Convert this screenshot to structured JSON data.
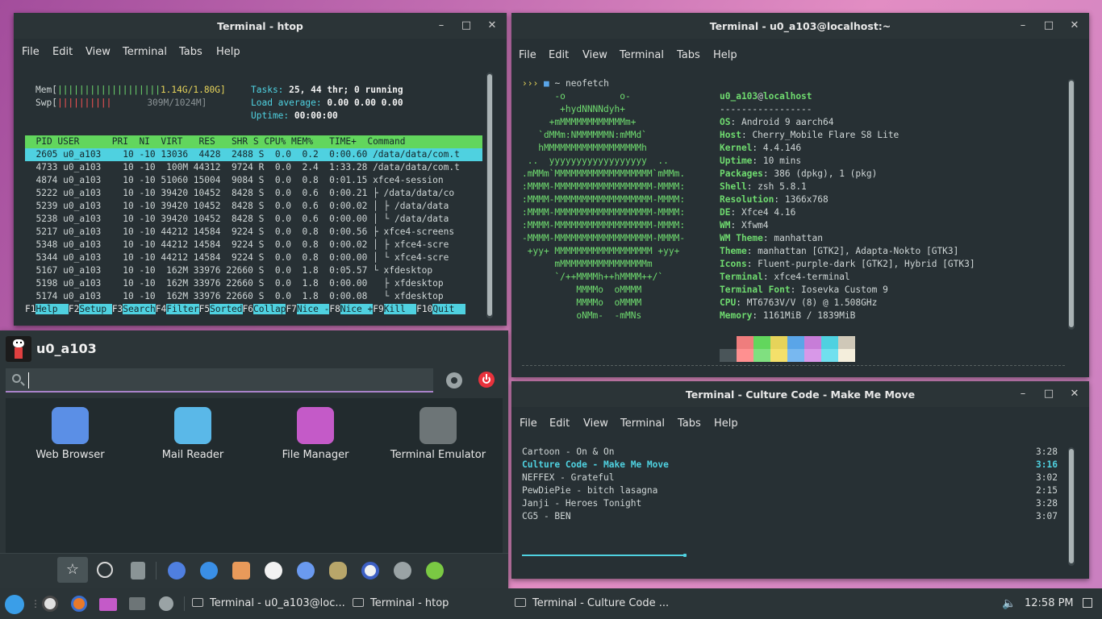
{
  "htop": {
    "title": "Terminal - htop",
    "menu": [
      "File",
      "Edit",
      "View",
      "Terminal",
      "Tabs",
      "Help"
    ],
    "mem_label": "Mem[",
    "mem_bar": "|||||||||||||||||||",
    "mem_val": "1.14G/1.80G]",
    "swp_label": "Swp[",
    "swp_bar": "||||||||||",
    "swp_val": "309M/1024M]",
    "tasks_label": "Tasks:",
    "tasks_val": "25, 44 thr; 0 running",
    "load_label": "Load average:",
    "load_val": "0.00 0.00 0.00",
    "uptime_label": "Uptime:",
    "uptime_val": "00:00:00",
    "header": "  PID USER      PRI  NI  VIRT   RES   SHR S CPU% MEM%   TIME+  Command",
    "rows": [
      "  2605 u0_a103    10 -10 13036  4428  2488 S  0.0  0.2  0:00.60 /data/data/com.t",
      "  4733 u0_a103    10 -10  100M 44312  9724 R  0.0  2.4  1:33.28 /data/data/com.t",
      "  4874 u0_a103    10 -10 51060 15004  9084 S  0.0  0.8  0:01.15 xfce4-session",
      "  5222 u0_a103    10 -10 39420 10452  8428 S  0.0  0.6  0:00.21 ├ /data/data/co",
      "  5239 u0_a103    10 -10 39420 10452  8428 S  0.0  0.6  0:00.02 │ ├ /data/data",
      "  5238 u0_a103    10 -10 39420 10452  8428 S  0.0  0.6  0:00.00 │ └ /data/data",
      "  5217 u0_a103    10 -10 44212 14584  9224 S  0.0  0.8  0:00.56 ├ xfce4-screens",
      "  5348 u0_a103    10 -10 44212 14584  9224 S  0.0  0.8  0:00.02 │ ├ xfce4-scre",
      "  5344 u0_a103    10 -10 44212 14584  9224 S  0.0  0.8  0:00.00 │ └ xfce4-scre",
      "  5167 u0_a103    10 -10  162M 33976 22660 S  0.0  1.8  0:05.57 └ xfdesktop",
      "  5198 u0_a103    10 -10  162M 33976 22660 S  0.0  1.8  0:00.00   ├ xfdesktop",
      "  5174 u0_a103    10 -10  162M 33976 22660 S  0.0  1.8  0:00.08   └ xfdesktop"
    ],
    "fkeys": [
      {
        "k": "F1",
        "l": "Help  "
      },
      {
        "k": "F2",
        "l": "Setup "
      },
      {
        "k": "F3",
        "l": "Search"
      },
      {
        "k": "F4",
        "l": "Filter"
      },
      {
        "k": "F5",
        "l": "Sorted"
      },
      {
        "k": "F6",
        "l": "Collap"
      },
      {
        "k": "F7",
        "l": "Nice -"
      },
      {
        "k": "F8",
        "l": "Nice +"
      },
      {
        "k": "F9",
        "l": "Kill  "
      },
      {
        "k": "F10",
        "l": "Quit  "
      }
    ]
  },
  "neofetch": {
    "title": "Terminal - u0_a103@localhost:~",
    "menu": [
      "File",
      "Edit",
      "View",
      "Terminal",
      "Tabs",
      "Help"
    ],
    "prompt": "›››",
    "prompt_dir": "~",
    "command": "neofetch",
    "art": [
      "      -o          o-",
      "       +hydNNNNdyh+",
      "     +mMMMMMMMMMMMMm+",
      "   `dMMm:NMMMMMMN:mMMd`",
      "   hMMMMMMMMMMMMMMMMMMh",
      " ..  yyyyyyyyyyyyyyyyyy  ..",
      ".mMMm`MMMMMMMMMMMMMMMMMM`mMMm.",
      ":MMMM-MMMMMMMMMMMMMMMMMM-MMMM:",
      ":MMMM-MMMMMMMMMMMMMMMMMM-MMMM:",
      ":MMMM-MMMMMMMMMMMMMMMMMM-MMMM:",
      ":MMMM-MMMMMMMMMMMMMMMMMM-MMMM:",
      "-MMMM-MMMMMMMMMMMMMMMMMM-MMMM-",
      " +yy+ MMMMMMMMMMMMMMMMMM +yy+",
      "      mMMMMMMMMMMMMMMMMm",
      "      `/++MMMMh++hMMMM++/`",
      "          MMMMo  oMMMM",
      "          MMMMo  oMMMM",
      "          oNMm-  -mMNs"
    ],
    "user": "u0_a103",
    "at": "@",
    "host": "localhost",
    "sep": "-----------------",
    "info": [
      {
        "k": "OS",
        "v": "Android 9 aarch64"
      },
      {
        "k": "Host",
        "v": "Cherry_Mobile Flare S8 Lite"
      },
      {
        "k": "Kernel",
        "v": "4.4.146"
      },
      {
        "k": "Uptime",
        "v": "10 mins"
      },
      {
        "k": "Packages",
        "v": "386 (dpkg), 1 (pkg)"
      },
      {
        "k": "Shell",
        "v": "zsh 5.8.1"
      },
      {
        "k": "Resolution",
        "v": "1366x768"
      },
      {
        "k": "DE",
        "v": "Xfce4 4.16"
      },
      {
        "k": "WM",
        "v": "Xfwm4"
      },
      {
        "k": "WM Theme",
        "v": "manhattan"
      },
      {
        "k": "Theme",
        "v": "manhattan [GTK2], Adapta-Nokto [GTK3]"
      },
      {
        "k": "Icons",
        "v": "Fluent-purple-dark [GTK2], Hybrid [GTK3]"
      },
      {
        "k": "Terminal",
        "v": "xfce4-terminal"
      },
      {
        "k": "Terminal Font",
        "v": "Iosevka Custom 9"
      },
      {
        "k": "CPU",
        "v": "MT6763V/V (8) @ 1.508GHz"
      },
      {
        "k": "Memory",
        "v": "1161MiB / 1839MiB"
      }
    ],
    "colors_top": [
      "#273034",
      "#ef7d7d",
      "#62d65d",
      "#e6d35a",
      "#5aa5e8",
      "#c77dd8",
      "#4fd1e0",
      "#cfc8b8"
    ],
    "colors_bottom": [
      "#4a5559",
      "#ff9090",
      "#80e080",
      "#f4e06a",
      "#78b8f0",
      "#d898e8",
      "#70e0ee",
      "#f4eedc"
    ]
  },
  "music": {
    "title": "Terminal - Culture Code - Make Me Move",
    "menu": [
      "File",
      "Edit",
      "View",
      "Terminal",
      "Tabs",
      "Help"
    ],
    "tracks": [
      {
        "name": "Cartoon - On & On",
        "time": "3:28"
      },
      {
        "name": "Culture Code - Make Me Move",
        "time": "3:16"
      },
      {
        "name": "NEFFEX - Grateful",
        "time": "3:02"
      },
      {
        "name": "PewDiePie - bitch lasagna",
        "time": "2:15"
      },
      {
        "name": "Janji - Heroes Tonight",
        "time": "3:28"
      },
      {
        "name": "CG5 - BEN",
        "time": "3:07"
      }
    ],
    "progress": 0.3
  },
  "launcher": {
    "username": "u0_a103",
    "search_placeholder": "",
    "apps": [
      {
        "name": "Web Browser",
        "color": "#5b8fe6"
      },
      {
        "name": "Mail Reader",
        "color": "#5ab8e8"
      },
      {
        "name": "File Manager",
        "color": "#c45ac8"
      },
      {
        "name": "Terminal Emulator",
        "color": "#6d7577"
      }
    ]
  },
  "taskbar": {
    "tasks": [
      "Terminal - u0_a103@loc...",
      "Terminal - htop",
      "Terminal - Culture Code ..."
    ],
    "clock": "12:58 PM"
  }
}
